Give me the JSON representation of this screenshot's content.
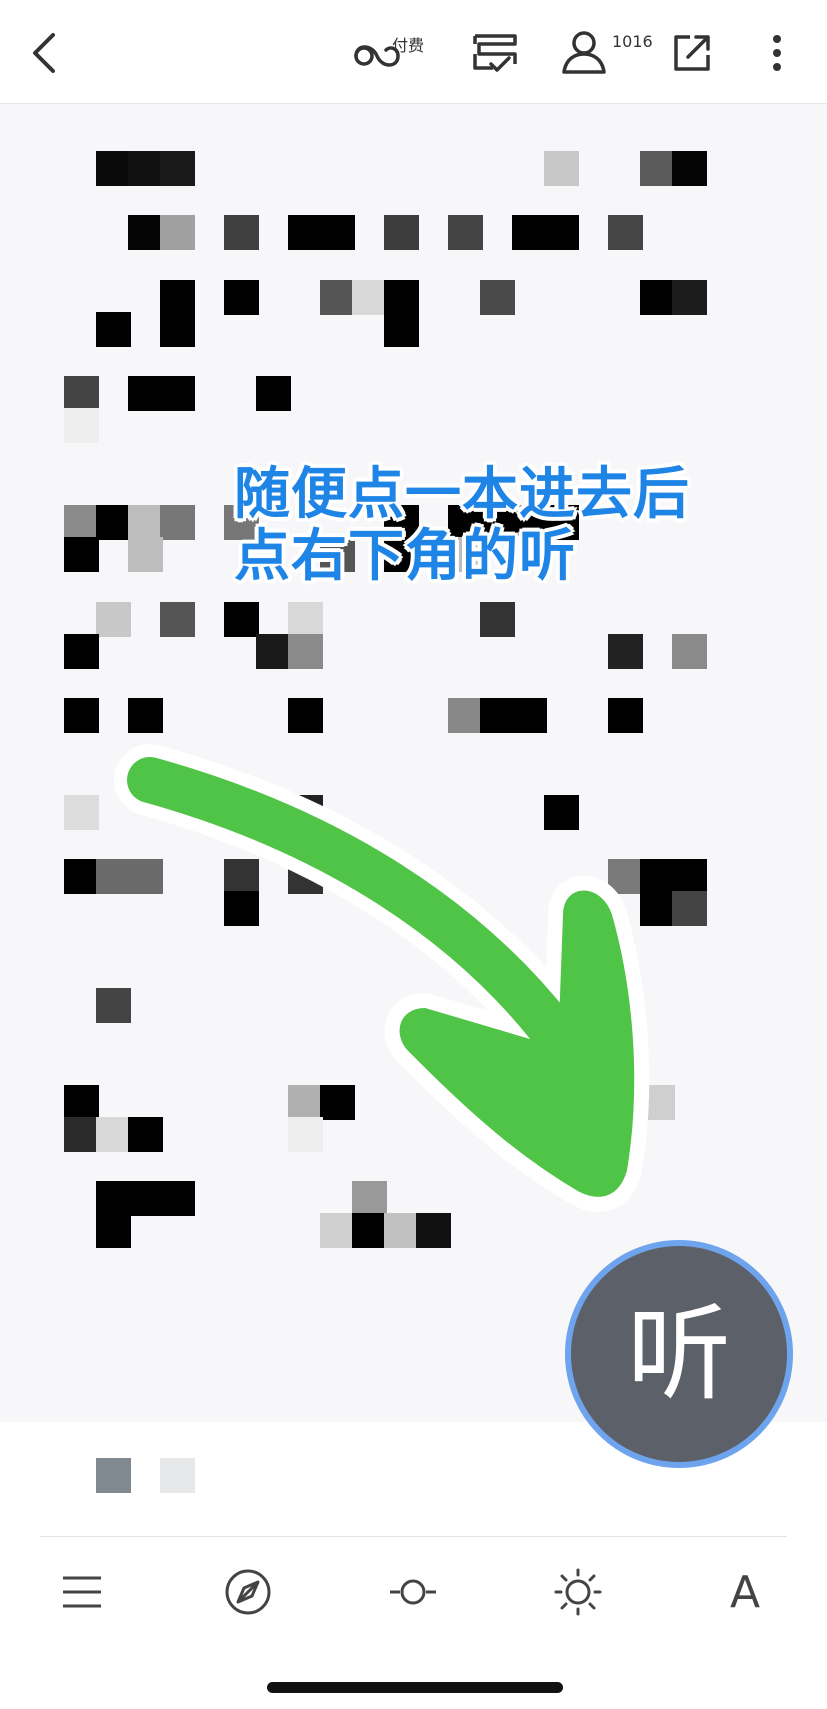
{
  "top_bar": {
    "pay_label": "付费",
    "follower_count": "1016"
  },
  "annotation": {
    "line1": "随便点一本进去后",
    "line2": "点右下角的听",
    "color": "#1e84e6"
  },
  "listen_button": {
    "label": "听",
    "fill_color": "#5c6068",
    "ring_color": "#6ea4ee"
  },
  "arrow": {
    "color": "#4fc447"
  },
  "bottom_toolbar": {
    "font_label": "A"
  },
  "icons": {
    "top": [
      "back-icon",
      "pay-loop-icon",
      "tasks-icon",
      "followers-icon",
      "share-icon",
      "more-icon"
    ],
    "bottom": [
      "menu-icon",
      "compass-icon",
      "progress-icon",
      "brightness-icon",
      "font-icon"
    ]
  }
}
